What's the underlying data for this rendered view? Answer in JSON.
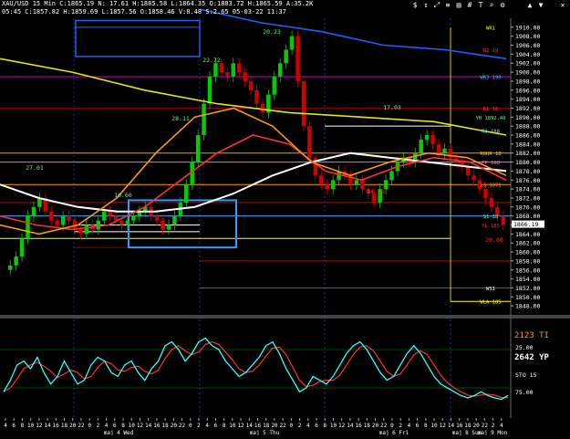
{
  "window": {
    "title_line": "XAU/USD  15 Min  C:1865.19  N:  17.61  H:1885.58  L:1864.35  O:1883.72  H:1865.59  A:35.2K",
    "sub_line": "05:45  C:1857.82  H:1859.69  L:1857.56  O:1858.46  V:8.48  S:2.65  05-03-22  11:37"
  },
  "toolbar": {
    "icons": [
      "dollar-icon",
      "arrow-icon",
      "expand-icon",
      "list-icon",
      "chart-icon",
      "grid-icon",
      "text-icon",
      "zoom-icon",
      "settings-icon",
      "up-icon",
      "down-icon",
      "close-icon"
    ]
  },
  "colors": {
    "background": "#000000",
    "price_up": "#00cc00",
    "price_down": "#cc0000",
    "ma_blue": "#1e5fff",
    "ma_yellow": "#e6e600",
    "ma_white": "#ffffff",
    "ma_red": "#ff3030",
    "ma_orange": "#ff9900",
    "stoch_cyan": "#33ffff",
    "stoch_red": "#ff3030",
    "box_blue": "#3399ff"
  },
  "chart_data": {
    "type": "line",
    "title": "XAU/USD 15 Min",
    "price_axis": {
      "ylim": [
        1846,
        1912
      ],
      "ticks": [
        "1910.00",
        "1908.00",
        "1906.00",
        "1904.00",
        "1902.00",
        "1900.00",
        "1898.00",
        "1896.00",
        "1894.00",
        "1892.00",
        "1890.00",
        "1888.00",
        "1886.00",
        "1884.00",
        "1882.00",
        "1880.00",
        "1878.00",
        "1876.00",
        "1874.00",
        "1872.00",
        "1870.00",
        "1868.00",
        "1866.00",
        "1864.00",
        "1862.00",
        "1860.00",
        "1858.00",
        "1856.00",
        "1854.00",
        "1852.00",
        "1850.00",
        "1848.00"
      ],
      "last_price_label": "1866.19"
    },
    "time_axis": {
      "ticks": [
        "4",
        "6",
        "8",
        "10",
        "12",
        "14",
        "16",
        "18",
        "20",
        "22",
        "0",
        "2",
        "4",
        "6",
        "8",
        "10",
        "12",
        "14",
        "16",
        "18",
        "20",
        "22",
        "0",
        "2",
        "4",
        "6",
        "8",
        "10",
        "12",
        "14",
        "16",
        "18",
        "20",
        "22",
        "0",
        "2",
        "4",
        "6",
        "8",
        "10",
        "12",
        "14",
        "16",
        "18",
        "20",
        "22",
        "0",
        "2",
        "4",
        "6",
        "8",
        "10",
        "12",
        "14",
        "16",
        "18",
        "20",
        "22",
        "2",
        "4"
      ],
      "day_labels": [
        "maj 4 Wed",
        "maj 5 Thu",
        "maj 6 Fri",
        "maj 8 Sun",
        "maj 9 Mon"
      ]
    },
    "close_prices": [
      1857,
      1859,
      1863,
      1868,
      1870,
      1872,
      1869,
      1867,
      1866,
      1868,
      1867,
      1865,
      1864,
      1866,
      1865,
      1867,
      1869,
      1868,
      1867,
      1866,
      1867,
      1868,
      1869,
      1870,
      1868,
      1867,
      1865,
      1866,
      1868,
      1871,
      1875,
      1880,
      1886,
      1893,
      1899,
      1902,
      1900,
      1899,
      1902,
      1900,
      1898,
      1896,
      1893,
      1891,
      1895,
      1899,
      1902,
      1905,
      1908,
      1898,
      1888,
      1881,
      1877,
      1875,
      1874,
      1876,
      1878,
      1877,
      1875,
      1876,
      1874,
      1873,
      1871,
      1874,
      1876,
      1878,
      1880,
      1881,
      1880,
      1882,
      1885,
      1886,
      1884,
      1882,
      1883,
      1881,
      1880,
      1879,
      1877,
      1876,
      1874,
      1872,
      1870,
      1868,
      1866
    ],
    "moving_averages": [
      {
        "name": "MA blue",
        "color": "#1e5fff",
        "values": [
          1914,
          1911,
          1909,
          1906,
          1905,
          1903
        ]
      },
      {
        "name": "MA yellow",
        "color": "#e6e600",
        "values": [
          1903,
          1900,
          1896,
          1893,
          1891,
          1890,
          1889,
          1886
        ]
      },
      {
        "name": "MA white",
        "color": "#ffffff",
        "values": [
          1875,
          1872,
          1870,
          1869,
          1869,
          1870,
          1873,
          1877,
          1880,
          1882,
          1881,
          1880,
          1879,
          1878
        ]
      },
      {
        "name": "MA red",
        "color": "#ff3030",
        "values": [
          1868,
          1866,
          1865,
          1866,
          1870,
          1876,
          1882,
          1886,
          1884,
          1878,
          1876,
          1879,
          1881,
          1880,
          1876
        ]
      },
      {
        "name": "MA orange",
        "color": "#ff9900",
        "values": [
          1866,
          1864,
          1866,
          1872,
          1882,
          1890,
          1892,
          1888,
          1880,
          1877,
          1880,
          1882,
          1881,
          1877
        ]
      }
    ],
    "level_labels": [
      {
        "text": "WR1",
        "price": 1910,
        "color": "#ffff00"
      },
      {
        "text": "R2 19",
        "price": 1905,
        "color": "#ff3030"
      },
      {
        "text": "WR3 190",
        "price": 1899,
        "color": "#33ccff"
      },
      {
        "text": "R1 18",
        "price": 1892,
        "color": "#ff3030"
      },
      {
        "text": "YH 1892.40",
        "price": 1890,
        "color": "#66ff66"
      },
      {
        "text": "R3 188",
        "price": 1887,
        "color": "#33ffff"
      },
      {
        "text": "ROUR 18",
        "price": 1882,
        "color": "#ffcc00"
      },
      {
        "text": "PP 188",
        "price": 1880,
        "color": "#ff66cc"
      },
      {
        "text": "L3 1871",
        "price": 1875,
        "color": "#ff9900"
      },
      {
        "text": "S1 18",
        "price": 1868,
        "color": "#66ff66"
      },
      {
        "text": "YL 185",
        "price": 1866,
        "color": "#ff3030"
      },
      {
        "text": "WS1",
        "price": 1852,
        "color": "#ffffff"
      },
      {
        "text": "WLA 185",
        "price": 1849,
        "color": "#ffff00"
      }
    ],
    "annotations": [
      {
        "text": "20.23",
        "color": "#66ff66"
      },
      {
        "text": "22.72",
        "color": "#66ff66"
      },
      {
        "text": "28.11",
        "color": "#66ff66"
      },
      {
        "text": "17.03",
        "color": "#66ff66"
      },
      {
        "text": "10.60",
        "color": "#66ff66"
      },
      {
        "text": "27.01",
        "color": "#66ff66"
      },
      {
        "text": "14.69",
        "color": "#ff3030"
      },
      {
        "text": "20.08",
        "color": "#ff3030"
      }
    ],
    "stoch": {
      "name": "STO 15",
      "labels": [
        "2123 TI",
        "2642 YP"
      ],
      "ticks": [
        "25.00",
        "75.00"
      ],
      "values": [
        20,
        35,
        55,
        60,
        50,
        65,
        45,
        30,
        40,
        60,
        45,
        30,
        35,
        55,
        65,
        60,
        45,
        40,
        55,
        60,
        45,
        35,
        50,
        60,
        80,
        85,
        75,
        60,
        70,
        85,
        90,
        80,
        75,
        60,
        50,
        40,
        45,
        55,
        65,
        80,
        85,
        70,
        50,
        35,
        20,
        25,
        40,
        35,
        30,
        40,
        55,
        70,
        80,
        85,
        75,
        60,
        45,
        35,
        40,
        55,
        70,
        80,
        70,
        55,
        40,
        30,
        25,
        20,
        15,
        12,
        15,
        20,
        15,
        12,
        10,
        15
      ]
    }
  }
}
